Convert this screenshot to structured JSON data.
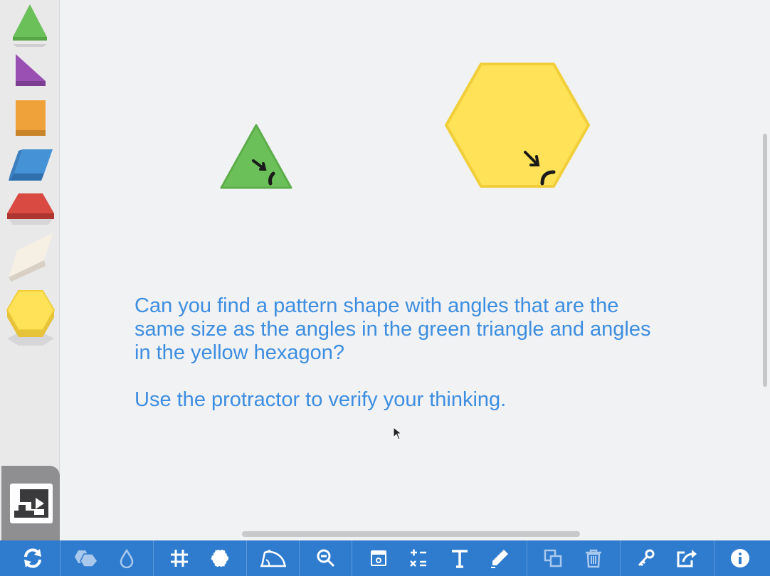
{
  "prompt": {
    "line1": "Can you find a pattern shape with angles that are the",
    "line2": "same size as the angles in the green triangle and angles",
    "line3": "in the yellow hexagon?",
    "line4": "Use the protractor to verify your thinking."
  },
  "colors": {
    "green": "#6cc05a",
    "purple": "#9a4fb3",
    "orange": "#f0a23a",
    "blue": "#4592d6",
    "red": "#d94a43",
    "tan": "#f4ece1",
    "yellow": "#ffe257",
    "toolbar": "#2f7ccf",
    "text": "#3d8ee0"
  },
  "sidebar": {
    "pieces": [
      "triangle",
      "right-triangle",
      "square",
      "blue-rhombus",
      "trapezoid",
      "tan-rhombus",
      "hexagon"
    ]
  },
  "toolbar": {
    "buttons": [
      "refresh-icon",
      "shapes-icon",
      "fill-drop-icon",
      "grid-icon",
      "snap-hexagon-icon",
      "protractor-icon",
      "zoom-out-icon",
      "reveal-card-icon",
      "calculator-icon",
      "text-icon",
      "pencil-icon",
      "duplicate-icon",
      "trash-icon",
      "key-icon",
      "share-icon",
      "info-icon"
    ]
  }
}
